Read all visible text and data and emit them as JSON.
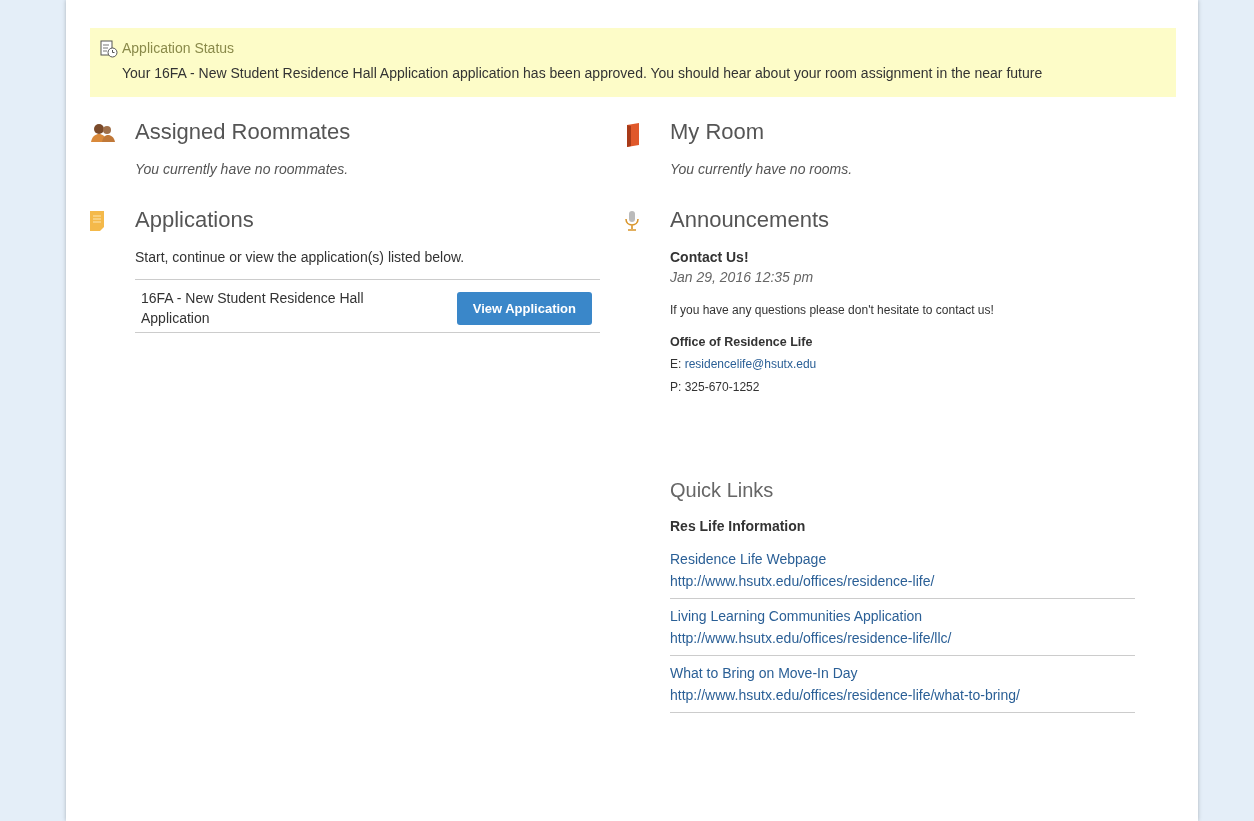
{
  "alert": {
    "title": "Application Status",
    "message": "Your 16FA - New Student Residence Hall Application application has been approved. You should hear about your room assignment in the near future"
  },
  "sections": [
    {
      "kind": "roommates",
      "title": "Assigned Roommates",
      "empty": "You currently have no roommates."
    },
    {
      "kind": "room",
      "title": "My Room",
      "empty": "You currently have no rooms."
    },
    {
      "kind": "applications",
      "title": "Applications",
      "intro": "Start, continue or view the application(s) listed below.",
      "items": [
        {
          "name": "16FA - New Student Residence Hall Application",
          "action": "View Application"
        }
      ]
    },
    {
      "kind": "announcements",
      "title": "Announcements",
      "posts": [
        {
          "title": "Contact Us!",
          "date": "Jan 29, 2016 12:35 pm",
          "body": "If you have any questions please don't hesitate to contact us!",
          "office": "Office of Residence Life",
          "email_label": "E:",
          "email": "residencelife@hsutx.edu",
          "phone": "P: 325-670-1252"
        }
      ]
    }
  ],
  "quick_links": {
    "title": "Quick Links",
    "group": "Res Life Information",
    "links": [
      {
        "label": "Residence Life Webpage",
        "url": "http://www.hsutx.edu/offices/residence-life/"
      },
      {
        "label": "Living Learning Communities Application",
        "url": "http://www.hsutx.edu/offices/residence-life/llc/"
      },
      {
        "label": "What to Bring on Move-In Day",
        "url": "http://www.hsutx.edu/offices/residence-life/what-to-bring/"
      }
    ]
  }
}
